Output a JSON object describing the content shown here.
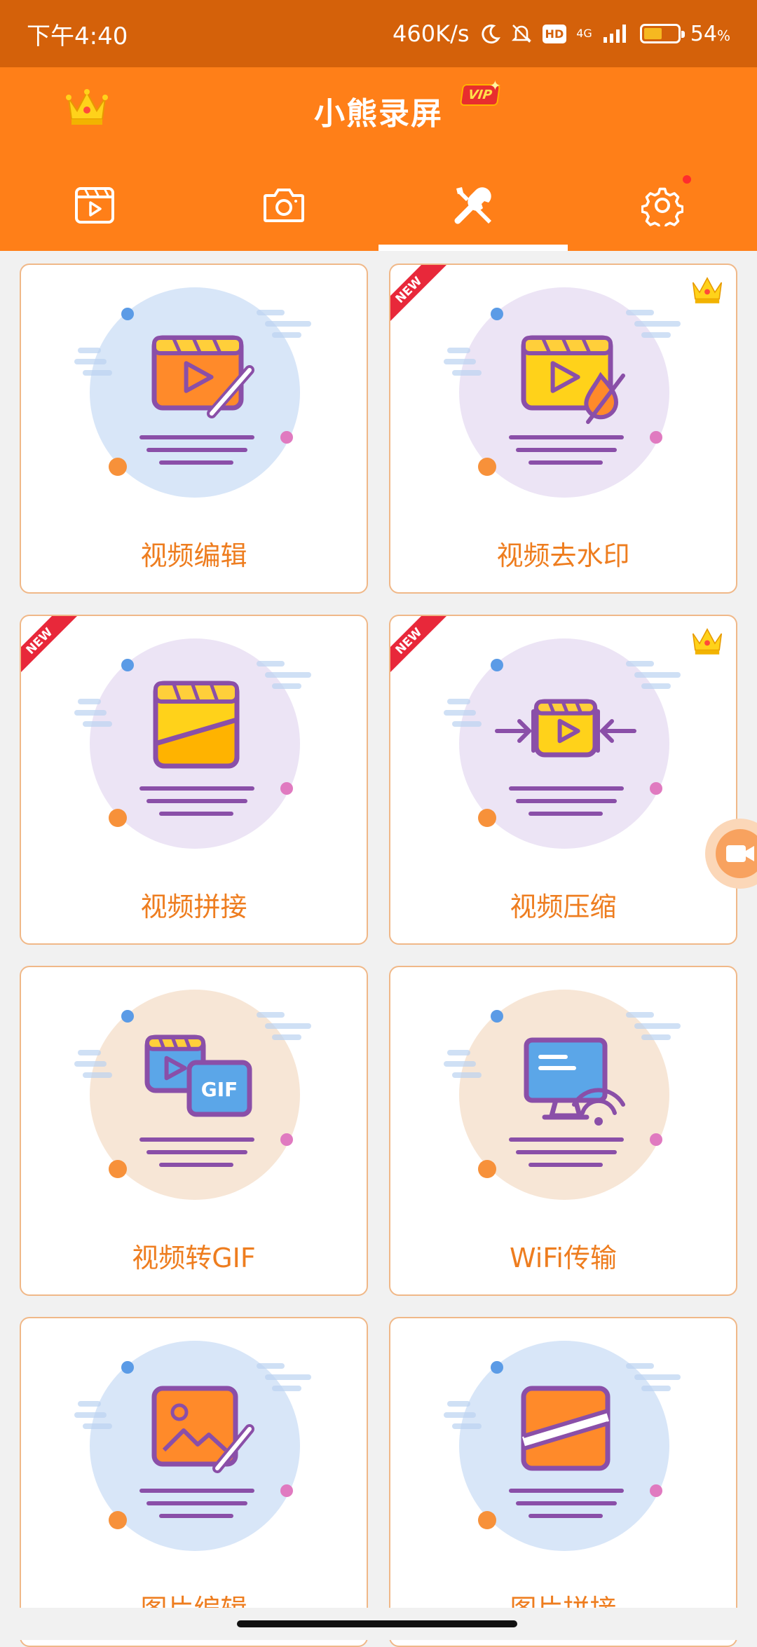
{
  "status_bar": {
    "time": "下午4:40",
    "speed": "460K/s",
    "hd": "HD",
    "network": "4G",
    "battery_pct": "54",
    "battery_unit": "%",
    "battery_level": 0.54
  },
  "header": {
    "app_title": "小熊录屏",
    "vip_badge": "VIP"
  },
  "tabs": [
    {
      "icon": "video-list-icon",
      "active": false
    },
    {
      "icon": "camera-icon",
      "active": false
    },
    {
      "icon": "tools-icon",
      "active": true
    },
    {
      "icon": "settings-icon",
      "active": false,
      "has_notification_dot": true
    }
  ],
  "ribbon_text": "NEW",
  "tools": [
    {
      "label": "视频编辑",
      "icon": "video-edit-icon",
      "new": false,
      "vip": false
    },
    {
      "label": "视频去水印",
      "icon": "remove-watermark-icon",
      "new": true,
      "vip": true
    },
    {
      "label": "视频拼接",
      "icon": "video-merge-icon",
      "new": true,
      "vip": false
    },
    {
      "label": "视频压缩",
      "icon": "video-compress-icon",
      "new": true,
      "vip": true
    },
    {
      "label": "视频转GIF",
      "icon": "video-to-gif-icon",
      "new": false,
      "vip": false
    },
    {
      "label": "WiFi传输",
      "icon": "wifi-transfer-icon",
      "new": false,
      "vip": false
    },
    {
      "label": "图片编辑",
      "icon": "image-edit-icon",
      "new": false,
      "vip": false
    },
    {
      "label": "图片拼接",
      "icon": "image-merge-icon",
      "new": false,
      "vip": false
    }
  ],
  "colors": {
    "status_bar": "#d4610a",
    "header": "#ff7f18",
    "label": "#ee7d1f",
    "card_border": "#f0b888",
    "circle_blue": "#d8e6f8",
    "circle_purple": "#ece4f5",
    "circle_peach": "#f7e6d6"
  }
}
